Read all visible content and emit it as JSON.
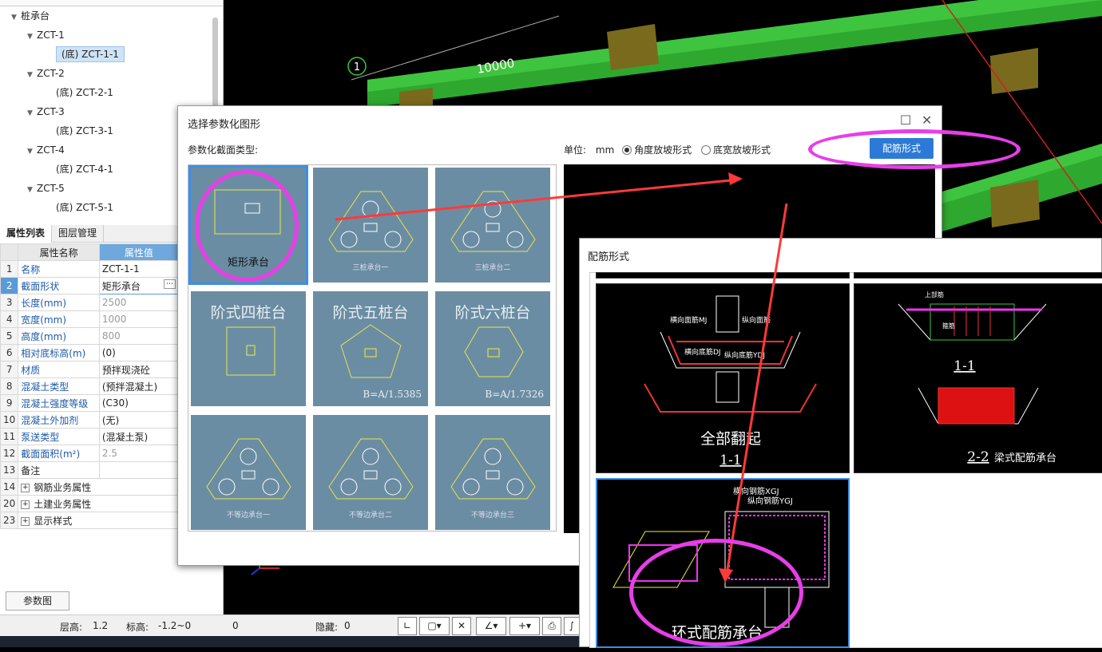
{
  "tree": {
    "root": "桩承台",
    "nodes": [
      {
        "label": "ZCT-1",
        "level": 1
      },
      {
        "label": "(底) ZCT-1-1",
        "level": 2,
        "selected": true
      },
      {
        "label": "ZCT-2",
        "level": 1
      },
      {
        "label": "(底) ZCT-2-1",
        "level": 2
      },
      {
        "label": "ZCT-3",
        "level": 1
      },
      {
        "label": "(底) ZCT-3-1",
        "level": 2
      },
      {
        "label": "ZCT-4",
        "level": 1
      },
      {
        "label": "(底) ZCT-4-1",
        "level": 2
      },
      {
        "label": "ZCT-5",
        "level": 1
      },
      {
        "label": "(底) ZCT-5-1",
        "level": 2
      }
    ]
  },
  "tabs": {
    "props": "属性列表",
    "layers": "图层管理"
  },
  "props": {
    "header_name": "属性名称",
    "header_value": "属性值",
    "rows": [
      {
        "n": "1",
        "k": "名称",
        "v": "ZCT-1-1",
        "kc": "blue",
        "vc": ""
      },
      {
        "n": "2",
        "k": "截面形状",
        "v": "矩形承台",
        "kc": "blue",
        "vc": ""
      },
      {
        "n": "3",
        "k": "长度(mm)",
        "v": "2500",
        "kc": "blue",
        "vc": "grey"
      },
      {
        "n": "4",
        "k": "宽度(mm)",
        "v": "1000",
        "kc": "blue",
        "vc": "grey"
      },
      {
        "n": "5",
        "k": "高度(mm)",
        "v": "800",
        "kc": "blue",
        "vc": "grey"
      },
      {
        "n": "6",
        "k": "相对底标高(m)",
        "v": "(0)",
        "kc": "blue",
        "vc": ""
      },
      {
        "n": "7",
        "k": "材质",
        "v": "预拌现浇砼",
        "kc": "blue",
        "vc": ""
      },
      {
        "n": "8",
        "k": "混凝土类型",
        "v": "(预拌混凝土)",
        "kc": "blue",
        "vc": ""
      },
      {
        "n": "9",
        "k": "混凝土强度等级",
        "v": "(C30)",
        "kc": "blue",
        "vc": ""
      },
      {
        "n": "10",
        "k": "混凝土外加剂",
        "v": "(无)",
        "kc": "blue",
        "vc": ""
      },
      {
        "n": "11",
        "k": "泵送类型",
        "v": "(混凝土泵)",
        "kc": "blue",
        "vc": ""
      },
      {
        "n": "12",
        "k": "截面面积(m²)",
        "v": "2.5",
        "kc": "blue",
        "vc": "grey"
      },
      {
        "n": "13",
        "k": "备注",
        "v": "",
        "kc": "",
        "vc": ""
      },
      {
        "n": "14",
        "k": "钢筋业务属性",
        "v": "",
        "kc": "",
        "vc": "",
        "group": true
      },
      {
        "n": "20",
        "k": "土建业务属性",
        "v": "",
        "kc": "",
        "vc": "",
        "group": true
      },
      {
        "n": "23",
        "k": "显示样式",
        "v": "",
        "kc": "",
        "vc": "",
        "group": true
      }
    ]
  },
  "param_button": "参数图",
  "status": {
    "floor": "层高:",
    "floor_v": "1.2",
    "elev": "标高:",
    "elev_v": "-1.2~0",
    "zero": "0",
    "hidden": "隐藏:",
    "hidden_v": "0"
  },
  "cad": {
    "axis_label": "1",
    "dimension": "10000"
  },
  "dialog": {
    "title": "选择参数化图形",
    "section_label": "参数化截面类型:",
    "unit_label": "单位:",
    "unit_value": "mm",
    "radio1": "角度放坡形式",
    "radio2": "底宽放坡形式",
    "rebar_button": "配筋形式",
    "shapes": [
      {
        "caption": "矩形承台",
        "kind": "rect"
      },
      {
        "caption": "三桩承台一",
        "kind": "tri1"
      },
      {
        "caption": "三桩承台二",
        "kind": "tri2"
      },
      {
        "caption": "阶式四桩台",
        "kind": "step4"
      },
      {
        "caption": "阶式五桩台",
        "kind": "step5",
        "formula": "B=A/1.5385"
      },
      {
        "caption": "阶式六桩台",
        "kind": "step6",
        "formula": "B=A/1.7326"
      },
      {
        "caption": "不等边承台一",
        "kind": "tri3"
      },
      {
        "caption": "不等边承台二",
        "kind": "tri4"
      },
      {
        "caption": "不等边承台三",
        "kind": "tri5"
      }
    ]
  },
  "rebar_dialog": {
    "title": "配筋形式",
    "p1": {
      "caption": "全部翻起",
      "section": "1-1",
      "t1": "横向面筋MJ",
      "t2": "纵向面筋",
      "t3": "横向底筋DJ",
      "t4": "纵向底筋YDJ"
    },
    "p2": {
      "caption": "梁式配筋承台",
      "s1": "1-1",
      "s2": "2-2",
      "t1": "上部筋",
      "t2": "箍筋"
    },
    "p3": {
      "caption": "环式配筋承台",
      "t1": "横向钢筋XGJ",
      "t2": "纵向钢筋YGJ"
    }
  },
  "colors": {
    "annotation": "#e83ee8",
    "arrow": "#ff3a3a",
    "beam": "#2ea82e",
    "cell": "#6b8da3"
  }
}
